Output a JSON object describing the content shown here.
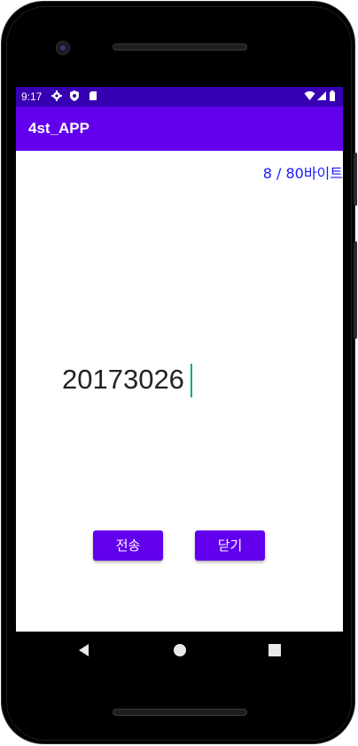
{
  "status_bar": {
    "time": "9:17",
    "icons": [
      "gear-icon",
      "shield-icon",
      "sd-card-icon",
      "wifi-icon",
      "signal-icon",
      "battery-icon"
    ]
  },
  "app_bar": {
    "title": "4st_APP",
    "color": "#6200ee"
  },
  "byte_counter": {
    "text": "8 / 80바이트",
    "color": "#1a1aff"
  },
  "message_input": {
    "value": "20173026"
  },
  "buttons": {
    "send_label": "전송",
    "close_label": "닫기"
  },
  "nav_bar": {
    "icons": [
      "back-icon",
      "home-icon",
      "recents-icon"
    ]
  },
  "colors": {
    "status_bar": "#3700b3",
    "accent": "#6200ee",
    "cursor": "#03a58a"
  }
}
